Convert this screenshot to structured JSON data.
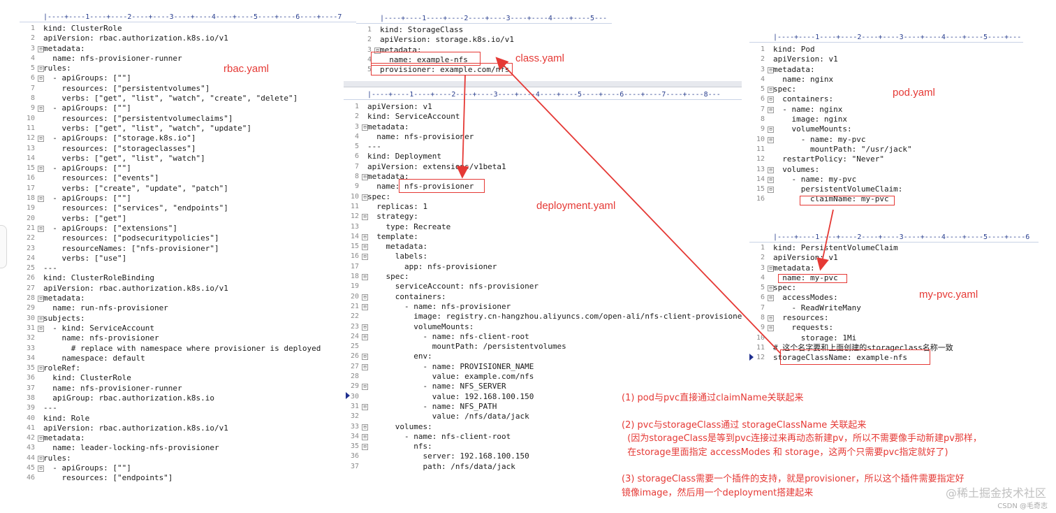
{
  "colors": {
    "annotation": "#e53935",
    "ruler_text": "#2a3f8f",
    "line_number": "#8a8a8a"
  },
  "rulers": {
    "rbac": "|----+----1----+----2----+----3----+----4----+----5----+----6----+----7",
    "class": "|----+----1----+----2----+----3----+----4----+----5---",
    "deployment": "|----+----1----+----2----+----3----+----4----+----5----+----6----+----7----+----8---",
    "pod": "|----+----1----+----2----+----3----+----4----+----5----+---",
    "pvc": "|----+----1----+----2----+----3----+----4----+----5----+----6"
  },
  "titles": {
    "rbac": "rbac.yaml",
    "class": "class.yaml",
    "deployment": "deployment.yaml",
    "pod": "pod.yaml",
    "pvc": "my-pvc.yaml"
  },
  "rbac_lines": [
    {
      "n": "1",
      "f": "",
      "t": "kind: ClusterRole"
    },
    {
      "n": "2",
      "f": "",
      "t": "apiVersion: rbac.authorization.k8s.io/v1"
    },
    {
      "n": "3",
      "f": "⊟",
      "t": "metadata:"
    },
    {
      "n": "4",
      "f": "",
      "t": "  name: nfs-provisioner-runner"
    },
    {
      "n": "5",
      "f": "⊟",
      "t": "rules:"
    },
    {
      "n": "6",
      "f": "⊟",
      "t": "  - apiGroups: [\"\"]"
    },
    {
      "n": "7",
      "f": "",
      "t": "    resources: [\"persistentvolumes\"]"
    },
    {
      "n": "8",
      "f": "",
      "t": "    verbs: [\"get\", \"list\", \"watch\", \"create\", \"delete\"]"
    },
    {
      "n": "9",
      "f": "⊟",
      "t": "  - apiGroups: [\"\"]"
    },
    {
      "n": "10",
      "f": "",
      "t": "    resources: [\"persistentvolumeclaims\"]"
    },
    {
      "n": "11",
      "f": "",
      "t": "    verbs: [\"get\", \"list\", \"watch\", \"update\"]"
    },
    {
      "n": "12",
      "f": "⊟",
      "t": "  - apiGroups: [\"storage.k8s.io\"]"
    },
    {
      "n": "13",
      "f": "",
      "t": "    resources: [\"storageclasses\"]"
    },
    {
      "n": "14",
      "f": "",
      "t": "    verbs: [\"get\", \"list\", \"watch\"]"
    },
    {
      "n": "15",
      "f": "⊟",
      "t": "  - apiGroups: [\"\"]"
    },
    {
      "n": "16",
      "f": "",
      "t": "    resources: [\"events\"]"
    },
    {
      "n": "17",
      "f": "",
      "t": "    verbs: [\"create\", \"update\", \"patch\"]"
    },
    {
      "n": "18",
      "f": "⊟",
      "t": "  - apiGroups: [\"\"]"
    },
    {
      "n": "19",
      "f": "",
      "t": "    resources: [\"services\", \"endpoints\"]"
    },
    {
      "n": "20",
      "f": "",
      "t": "    verbs: [\"get\"]"
    },
    {
      "n": "21",
      "f": "⊟",
      "t": "  - apiGroups: [\"extensions\"]"
    },
    {
      "n": "22",
      "f": "",
      "t": "    resources: [\"podsecuritypolicies\"]"
    },
    {
      "n": "23",
      "f": "",
      "t": "    resourceNames: [\"nfs-provisioner\"]"
    },
    {
      "n": "24",
      "f": "",
      "t": "    verbs: [\"use\"]"
    },
    {
      "n": "25",
      "f": "",
      "t": "---"
    },
    {
      "n": "26",
      "f": "",
      "t": "kind: ClusterRoleBinding"
    },
    {
      "n": "27",
      "f": "",
      "t": "apiVersion: rbac.authorization.k8s.io/v1"
    },
    {
      "n": "28",
      "f": "⊟",
      "t": "metadata:"
    },
    {
      "n": "29",
      "f": "",
      "t": "  name: run-nfs-provisioner"
    },
    {
      "n": "30",
      "f": "⊟",
      "t": "subjects:"
    },
    {
      "n": "31",
      "f": "⊟",
      "t": "  - kind: ServiceAccount"
    },
    {
      "n": "32",
      "f": "",
      "t": "    name: nfs-provisioner"
    },
    {
      "n": "33",
      "f": "",
      "t": "      # replace with namespace where provisioner is deployed"
    },
    {
      "n": "34",
      "f": "",
      "t": "    namespace: default"
    },
    {
      "n": "35",
      "f": "⊟",
      "t": "roleRef:"
    },
    {
      "n": "36",
      "f": "",
      "t": "  kind: ClusterRole"
    },
    {
      "n": "37",
      "f": "",
      "t": "  name: nfs-provisioner-runner"
    },
    {
      "n": "38",
      "f": "",
      "t": "  apiGroup: rbac.authorization.k8s.io"
    },
    {
      "n": "39",
      "f": "",
      "t": "---"
    },
    {
      "n": "40",
      "f": "",
      "t": "kind: Role"
    },
    {
      "n": "41",
      "f": "",
      "t": "apiVersion: rbac.authorization.k8s.io/v1"
    },
    {
      "n": "42",
      "f": "⊟",
      "t": "metadata:"
    },
    {
      "n": "43",
      "f": "",
      "t": "  name: leader-locking-nfs-provisioner"
    },
    {
      "n": "44",
      "f": "⊟",
      "t": "rules:"
    },
    {
      "n": "45",
      "f": "⊟",
      "t": "  - apiGroups: [\"\"]"
    },
    {
      "n": "46",
      "f": "",
      "t": "    resources: [\"endpoints\"]"
    }
  ],
  "class_lines": [
    {
      "n": "1",
      "f": "",
      "t": "kind: StorageClass"
    },
    {
      "n": "2",
      "f": "",
      "t": "apiVersion: storage.k8s.io/v1"
    },
    {
      "n": "3",
      "f": "⊟",
      "t": "metadata:"
    },
    {
      "n": "4",
      "f": "",
      "t": "  name: example-nfs"
    },
    {
      "n": "5",
      "f": "",
      "t": "provisioner: example.com/nfs"
    }
  ],
  "deployment_lines": [
    {
      "n": "1",
      "f": "",
      "t": "apiVersion: v1"
    },
    {
      "n": "2",
      "f": "",
      "t": "kind: ServiceAccount"
    },
    {
      "n": "3",
      "f": "⊟",
      "t": "metadata:"
    },
    {
      "n": "4",
      "f": "",
      "t": "  name: nfs-provisioner"
    },
    {
      "n": "5",
      "f": "",
      "t": "---"
    },
    {
      "n": "6",
      "f": "",
      "t": "kind: Deployment"
    },
    {
      "n": "7",
      "f": "",
      "t": "apiVersion: extensions/v1beta1"
    },
    {
      "n": "8",
      "f": "⊟",
      "t": "metadata:"
    },
    {
      "n": "9",
      "f": "",
      "t": "  name: nfs-provisioner"
    },
    {
      "n": "10",
      "f": "⊟",
      "t": "spec:"
    },
    {
      "n": "11",
      "f": "",
      "t": "  replicas: 1"
    },
    {
      "n": "12",
      "f": "⊟",
      "t": "  strategy:"
    },
    {
      "n": "13",
      "f": "",
      "t": "    type: Recreate"
    },
    {
      "n": "14",
      "f": "⊟",
      "t": "  template:"
    },
    {
      "n": "15",
      "f": "⊟",
      "t": "    metadata:"
    },
    {
      "n": "16",
      "f": "⊟",
      "t": "      labels:"
    },
    {
      "n": "17",
      "f": "",
      "t": "        app: nfs-provisioner"
    },
    {
      "n": "18",
      "f": "⊟",
      "t": "    spec:"
    },
    {
      "n": "19",
      "f": "",
      "t": "      serviceAccount: nfs-provisioner"
    },
    {
      "n": "20",
      "f": "⊟",
      "t": "      containers:"
    },
    {
      "n": "21",
      "f": "⊟",
      "t": "        - name: nfs-provisioner"
    },
    {
      "n": "22",
      "f": "",
      "t": "          image: registry.cn-hangzhou.aliyuncs.com/open-ali/nfs-client-provisioner"
    },
    {
      "n": "23",
      "f": "⊟",
      "t": "          volumeMounts:"
    },
    {
      "n": "24",
      "f": "⊟",
      "t": "            - name: nfs-client-root"
    },
    {
      "n": "25",
      "f": "",
      "t": "              mountPath: /persistentvolumes"
    },
    {
      "n": "26",
      "f": "⊟",
      "t": "          env:"
    },
    {
      "n": "27",
      "f": "⊟",
      "t": "            - name: PROVISIONER_NAME"
    },
    {
      "n": "28",
      "f": "",
      "t": "              value: example.com/nfs"
    },
    {
      "n": "29",
      "f": "⊟",
      "t": "            - name: NFS_SERVER"
    },
    {
      "n": "30",
      "f": "",
      "t": "              value: 192.168.100.150"
    },
    {
      "n": "31",
      "f": "⊟",
      "t": "            - name: NFS_PATH"
    },
    {
      "n": "32",
      "f": "",
      "t": "              value: /nfs/data/jack"
    },
    {
      "n": "33",
      "f": "⊟",
      "t": "      volumes:"
    },
    {
      "n": "34",
      "f": "⊟",
      "t": "        - name: nfs-client-root"
    },
    {
      "n": "35",
      "f": "⊟",
      "t": "          nfs:"
    },
    {
      "n": "36",
      "f": "",
      "t": "            server: 192.168.100.150"
    },
    {
      "n": "37",
      "f": "",
      "t": "            path: /nfs/data/jack"
    }
  ],
  "pod_lines": [
    {
      "n": "1",
      "f": "",
      "t": "kind: Pod"
    },
    {
      "n": "2",
      "f": "",
      "t": "apiVersion: v1"
    },
    {
      "n": "3",
      "f": "⊟",
      "t": "metadata:"
    },
    {
      "n": "4",
      "f": "",
      "t": "  name: nginx"
    },
    {
      "n": "5",
      "f": "⊟",
      "t": "spec:"
    },
    {
      "n": "6",
      "f": "⊟",
      "t": "  containers:"
    },
    {
      "n": "7",
      "f": "⊟",
      "t": "  - name: nginx"
    },
    {
      "n": "8",
      "f": "",
      "t": "    image: nginx"
    },
    {
      "n": "9",
      "f": "⊟",
      "t": "    volumeMounts:"
    },
    {
      "n": "10",
      "f": "⊟",
      "t": "      - name: my-pvc"
    },
    {
      "n": "11",
      "f": "",
      "t": "        mountPath: \"/usr/jack\""
    },
    {
      "n": "12",
      "f": "",
      "t": "  restartPolicy: \"Never\""
    },
    {
      "n": "13",
      "f": "⊟",
      "t": "  volumes:"
    },
    {
      "n": "14",
      "f": "⊟",
      "t": "    - name: my-pvc"
    },
    {
      "n": "15",
      "f": "⊟",
      "t": "      persistentVolumeClaim:"
    },
    {
      "n": "16",
      "f": "",
      "t": "        claimName: my-pvc"
    }
  ],
  "pvc_lines": [
    {
      "n": "1",
      "f": "",
      "t": "kind: PersistentVolumeClaim"
    },
    {
      "n": "2",
      "f": "",
      "t": "apiVersion: v1"
    },
    {
      "n": "3",
      "f": "⊟",
      "t": "metadata:"
    },
    {
      "n": "4",
      "f": "",
      "t": "  name: my-pvc"
    },
    {
      "n": "5",
      "f": "⊟",
      "t": "spec:"
    },
    {
      "n": "6",
      "f": "⊟",
      "t": "  accessModes:"
    },
    {
      "n": "7",
      "f": "",
      "t": "    - ReadWriteMany"
    },
    {
      "n": "8",
      "f": "⊟",
      "t": "  resources:"
    },
    {
      "n": "9",
      "f": "⊟",
      "t": "    requests:"
    },
    {
      "n": "10",
      "f": "",
      "t": "      storage: 1Mi"
    },
    {
      "n": "11",
      "f": "",
      "t": "# 这个名字要和上面创建的storageclass名称一致"
    },
    {
      "n": "12",
      "f": "",
      "t": "storageClassName: example-nfs"
    }
  ],
  "notes": {
    "line1": "(1) pod与pvc直接通过claimName关联起来",
    "line2": "(2) pvc与storageClass通过 storageClassName 关联起来",
    "line3": "  (因为storageClass是等到pvc连接过来再动态新建pv，所以不需要像手动新建pv那样，",
    "line4": "  在storage里面指定 accessModes 和 storage，这两个只需要pvc指定就好了)",
    "line5": "(3) storageClass需要一个插件的支持，就是provisioner，所以这个插件需要指定好",
    "line6": "镜像image，然后用一个deployment搭建起来"
  },
  "watermark": {
    "main": "@稀土掘金技术社区",
    "sub": "CSDN @毛奇志"
  }
}
